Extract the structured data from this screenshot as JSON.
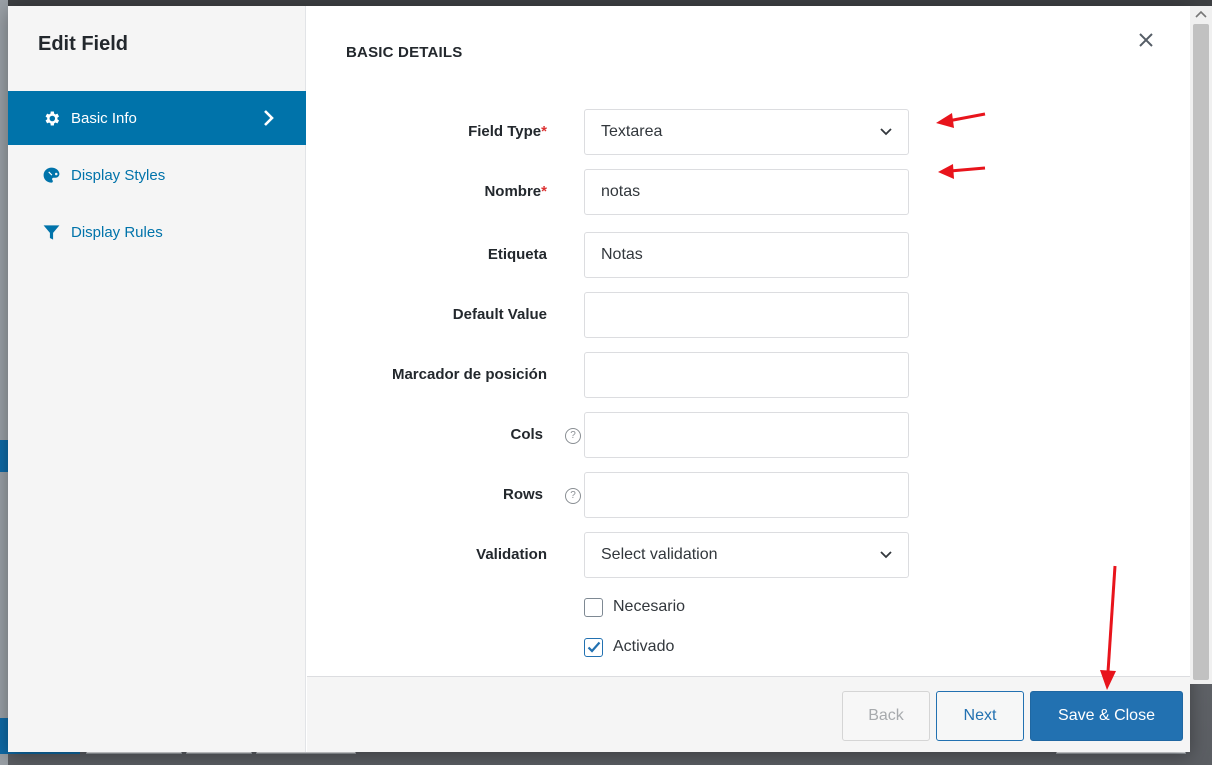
{
  "modal": {
    "title": "Edit Field",
    "section_title": "BASIC DETAILS",
    "close_label": "×"
  },
  "sidebar": {
    "items": [
      {
        "label": "Basic Info",
        "icon": "gear-icon",
        "active": true
      },
      {
        "label": "Display Styles",
        "icon": "palette-icon",
        "active": false
      },
      {
        "label": "Display Rules",
        "icon": "filter-icon",
        "active": false
      }
    ]
  },
  "form": {
    "field_type": {
      "label": "Field Type",
      "required_mark": "*",
      "value": "Textarea"
    },
    "nombre": {
      "label": "Nombre",
      "required_mark": "*",
      "value": "notas"
    },
    "etiqueta": {
      "label": "Etiqueta",
      "value": "Notas"
    },
    "default_value": {
      "label": "Default Value",
      "value": ""
    },
    "marcador": {
      "label": "Marcador de posición",
      "value": ""
    },
    "cols": {
      "label": "Cols",
      "help": "?",
      "value": ""
    },
    "rows": {
      "label": "Rows",
      "help": "?",
      "value": ""
    },
    "validation": {
      "label": "Validation",
      "value": "Select validation"
    },
    "necesario": {
      "label": "Necesario",
      "checked": false
    },
    "activado": {
      "label": "Activado",
      "checked": true
    }
  },
  "footer": {
    "back_label": "Back",
    "next_label": "Next",
    "save_label": "Save & Close"
  },
  "colors": {
    "accent": "#0073aa",
    "primary_button": "#2271b1",
    "required": "#dc3232",
    "annotation_arrow": "#e8141c"
  }
}
